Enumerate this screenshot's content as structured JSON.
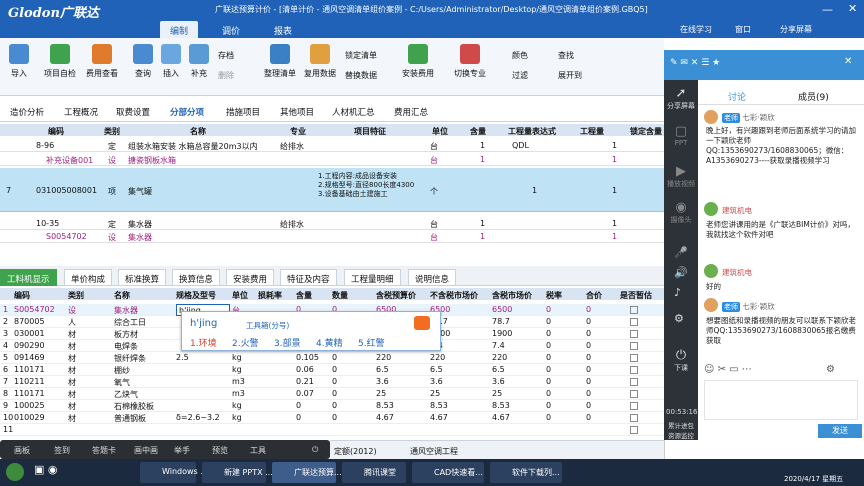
{
  "window": {
    "logo": "Glodon广联达",
    "title": "广联达预算计价 - [清单计价 - 通风空调清单组价案例 - C:/Users/Administrator/Desktop/通风空调清单组价案例.GBQ5]",
    "online": "在线学习",
    "window_menu": "窗口",
    "share": "分享屏幕"
  },
  "menubar": {
    "tabs": [
      "编制",
      "调价",
      "报表"
    ]
  },
  "ribbon": {
    "buttons": [
      "导入",
      "项目自检",
      "费用查看",
      "查询",
      "插入",
      "补充",
      "整理清单",
      "复用数据",
      "安装费用",
      "切换专业"
    ],
    "small": [
      "存档",
      "删除",
      "锁定清单",
      "替换数据",
      "颜色",
      "查找",
      "过滤",
      "展开到"
    ]
  },
  "tabs": [
    "造价分析",
    "工程概况",
    "取费设置",
    "分部分项",
    "措施项目",
    "其他项目",
    "人材机汇总",
    "费用汇总"
  ],
  "grid1": {
    "headers": [
      "编码",
      "类别",
      "名称",
      "专业",
      "项目特征",
      "单位",
      "含量",
      "工程量表达式",
      "工程量",
      "锁定含量"
    ],
    "rows": [
      {
        "no": "",
        "code": "8-96",
        "type": "定",
        "name": "组装水箱安装  水箱总容量20m3以内",
        "spec": "给排水",
        "feature": "",
        "unit": "台",
        "qty": "1",
        "expr": "QDL",
        "amount": "1"
      },
      {
        "no": "",
        "code": "补充设备001",
        "type": "设",
        "name": "搪瓷钢板水箱",
        "spec": "",
        "feature": "",
        "unit": "台",
        "qty": "1",
        "expr": "",
        "amount": "1"
      },
      {
        "no": "7",
        "code": "031005008001",
        "type": "项",
        "name": "集气罐",
        "spec": "",
        "feature": "1.工程内容:成品设备安装\n2.规格型号:直径800长度4300\n3.设备基础由土建施工",
        "unit": "个",
        "qty": "",
        "expr": "1",
        "amount": "1"
      },
      {
        "no": "",
        "code": "10-35",
        "type": "定",
        "name": "集水器",
        "spec": "给排水",
        "feature": "",
        "unit": "台",
        "qty": "1",
        "expr": "",
        "amount": "1"
      },
      {
        "no": "",
        "code": "S0054702",
        "type": "设",
        "name": "集水器",
        "spec": "",
        "feature": "",
        "unit": "台",
        "qty": "1",
        "expr": "",
        "amount": "1"
      }
    ]
  },
  "grid2tabs": [
    "工料机显示",
    "单价构成",
    "标准换算",
    "换算信息",
    "安装费用",
    "特征及内容",
    "工程量明细",
    "说明信息"
  ],
  "grid2": {
    "headers": [
      "编码",
      "类别",
      "名称",
      "规格及型号",
      "单位",
      "损耗率",
      "含量",
      "数量",
      "含税预算价",
      "不含税市场价",
      "含税市场价",
      "税率",
      "合价",
      "是否暂估"
    ],
    "rows": [
      [
        "S0054702",
        "设",
        "集水器",
        "",
        "台",
        "",
        "0",
        "0",
        "6500",
        "6500",
        "6500",
        "0",
        "0"
      ],
      [
        "870005",
        "人",
        "综合工日",
        "",
        "工日",
        "",
        "0",
        "0",
        "78.7",
        "78.7",
        "78.7",
        "0",
        "0"
      ],
      [
        "030001",
        "材",
        "板方材",
        "",
        "m3",
        "",
        "0",
        "0",
        "1900",
        "1900",
        "1900",
        "0",
        "0"
      ],
      [
        "090290",
        "材",
        "电焊条",
        "",
        "kg",
        "",
        "0",
        "0",
        "7.4",
        "7.4",
        "7.4",
        "0",
        "0"
      ],
      [
        "091469",
        "材",
        "银纤焊条",
        "2.5",
        "kg",
        "",
        "0.105",
        "0",
        "220",
        "220",
        "220",
        "0",
        "0"
      ],
      [
        "110171",
        "材",
        "棚纱",
        "",
        "kg",
        "",
        "0.06",
        "0",
        "6.5",
        "6.5",
        "6.5",
        "0",
        "0"
      ],
      [
        "110211",
        "材",
        "氧气",
        "",
        "m3",
        "",
        "0.21",
        "0",
        "3.6",
        "3.6",
        "3.6",
        "0",
        "0"
      ],
      [
        "110171",
        "材",
        "乙炔气",
        "",
        "m3",
        "",
        "0.07",
        "0",
        "25",
        "25",
        "25",
        "0",
        "0"
      ],
      [
        "100025",
        "材",
        "石棉橡胶板",
        "",
        "kg",
        "",
        "0",
        "0",
        "8.53",
        "8.53",
        "8.53",
        "0",
        "0"
      ],
      [
        "010029",
        "材",
        "普通钢板",
        "δ=2.6~3.2",
        "kg",
        "",
        "0",
        "0",
        "4.67",
        "4.67",
        "4.67",
        "0",
        "0"
      ],
      [
        "",
        "",
        "",
        "",
        "",
        "",
        "",
        "",
        "",
        "",
        "",
        "",
        ""
      ]
    ],
    "editing": "h'jing"
  },
  "ime": {
    "input": "h'jing",
    "tool": "工具箱(分号)",
    "candidates": [
      "1.环境",
      "2.火警",
      "3.部景",
      "4.黄精",
      "5.红警"
    ]
  },
  "bottombar": {
    "items": [
      "画板",
      "签到",
      "答题卡",
      "画中画",
      "举手",
      "预览",
      "工具"
    ]
  },
  "statusbar": {
    "items": [
      "定额(2012)",
      "通风空调工程"
    ]
  },
  "chat": {
    "tabs": [
      "讨论",
      "成员(9)"
    ],
    "sidebar": [
      "分享屏幕",
      "PPT",
      "播放视频",
      "摄像头",
      "下课"
    ],
    "timer": "00:53:16",
    "side_footer": "累计进包 资源监控",
    "messages": [
      {
        "name": "七彩·颖欣",
        "role": "老师",
        "text": "晚上好，有兴趣跟到老师后面系统学习的请加一下颖欣老师QQ:1353690273/1608830065；微信：A1353690273----获取录播视频学习"
      },
      {
        "name": "建筑机电",
        "role": "",
        "text": "老师您讲课用的是《广联达BIM计价》对吗，我就找这个软件对吧"
      },
      {
        "name": "建筑机电",
        "role": "",
        "text": "好的"
      },
      {
        "name": "七彩·颖欣",
        "role": "老师",
        "text": "想要图纸和录播视频的朋友可以联系下颖欣老师QQ:1353690273/1608830065报名缴费获取"
      }
    ],
    "send": "发送"
  },
  "taskbar": {
    "tasks": [
      "Windows ...",
      "新建 PPTX ...",
      "广联达预算...",
      "腾讯课堂",
      "CAD快速看...",
      "软件下载列..."
    ],
    "clock": "2020/4/17 星期五"
  }
}
